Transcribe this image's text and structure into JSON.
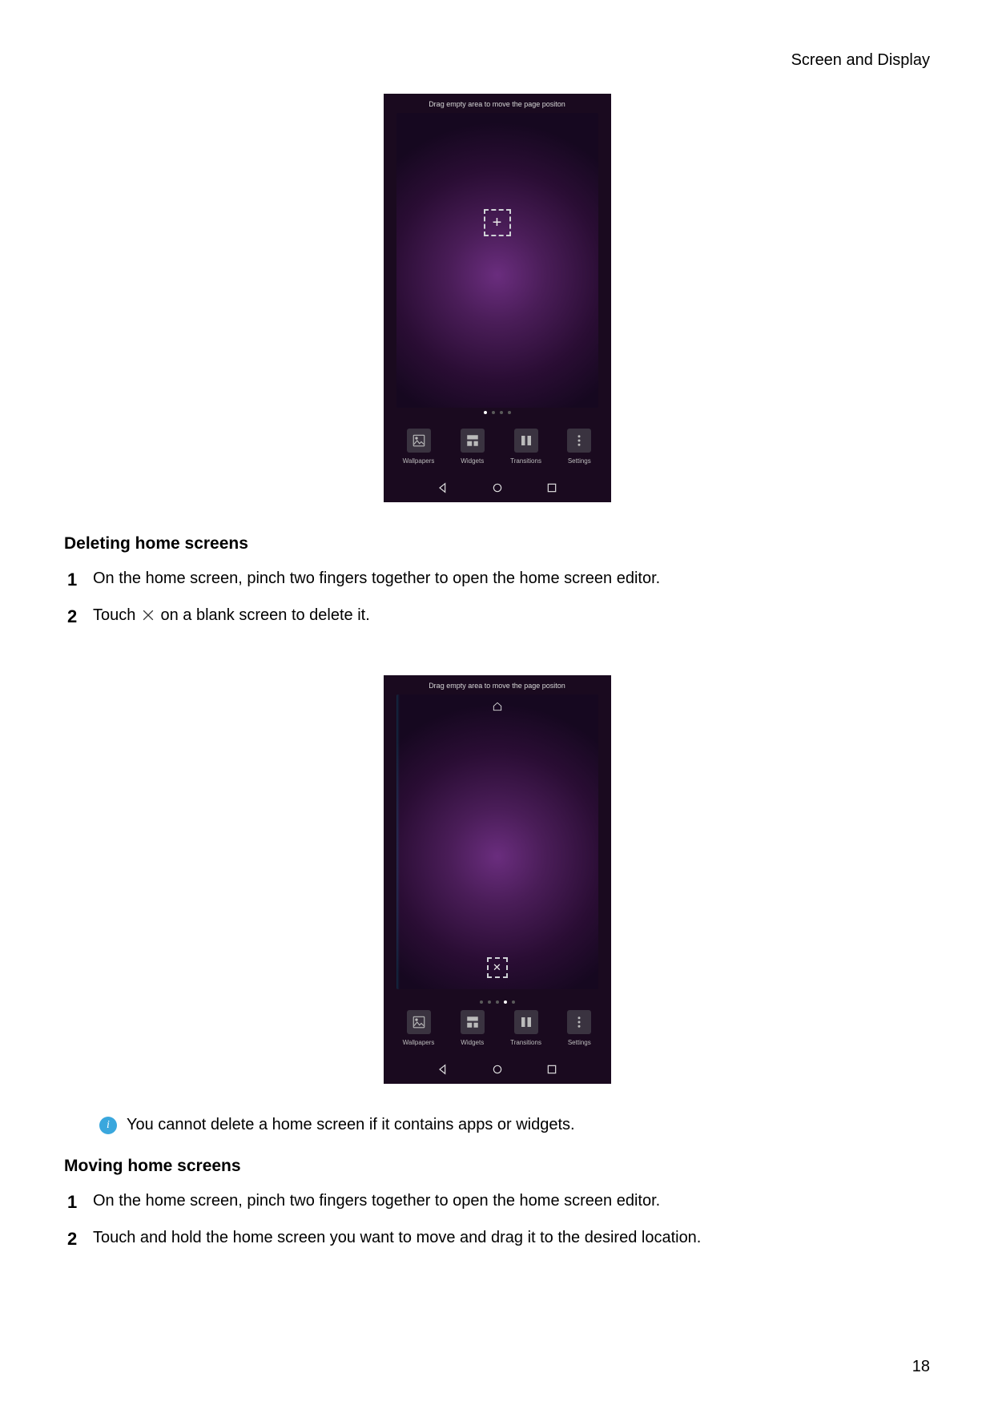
{
  "header": {
    "section_title": "Screen and Display"
  },
  "page_number": "18",
  "screenshot_common": {
    "hint_text": "Drag empty area to move the page positon",
    "panel": {
      "wallpapers": "Wallpapers",
      "widgets": "Widgets",
      "transitions": "Transitions",
      "settings": "Settings"
    },
    "plus_glyph": "+",
    "x_glyph": "✕"
  },
  "sections": {
    "deleting": {
      "heading": "Deleting home screens",
      "steps": {
        "s1_num": "1",
        "s1_text": "On the home screen, pinch two fingers together to open the home screen editor.",
        "s2_num": "2",
        "s2_pre": "Touch ",
        "s2_post": " on a blank screen to delete it."
      }
    },
    "note": {
      "icon_char": "i",
      "text": "You cannot delete a home screen if it contains apps or widgets."
    },
    "moving": {
      "heading": "Moving home screens",
      "steps": {
        "s1_num": "1",
        "s1_text": "On the home screen, pinch two fingers together to open the home screen editor.",
        "s2_num": "2",
        "s2_text": "Touch and hold the home screen you want to move and drag it to the desired location."
      }
    }
  }
}
